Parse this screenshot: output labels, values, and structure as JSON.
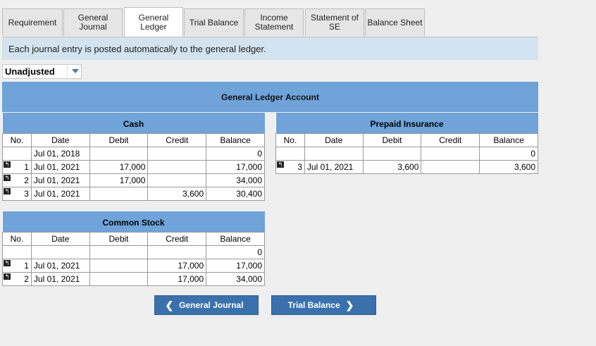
{
  "tabs": [
    {
      "label": "Requirement",
      "active": false
    },
    {
      "label": "General\nJournal",
      "active": false
    },
    {
      "label": "General\nLedger",
      "active": true
    },
    {
      "label": "Trial Balance",
      "active": false
    },
    {
      "label": "Income\nStatement",
      "active": false
    },
    {
      "label": "Statement of\nSE",
      "active": false
    },
    {
      "label": "Balance Sheet",
      "active": false
    }
  ],
  "notice": "Each journal entry is posted automatically to the general ledger.",
  "selector": {
    "value": "Unadjusted"
  },
  "gl_title": "General Ledger Account",
  "columns": {
    "no": "No.",
    "date": "Date",
    "debit": "Debit",
    "credit": "Credit",
    "balance": "Balance"
  },
  "cash": {
    "title": "Cash",
    "rows": [
      {
        "no": "",
        "date": "Jul 01, 2018",
        "debit": "",
        "credit": "",
        "balance": "0",
        "flag": false
      },
      {
        "no": "1",
        "date": "Jul 01, 2021",
        "debit": "17,000",
        "credit": "",
        "balance": "17,000",
        "flag": true
      },
      {
        "no": "2",
        "date": "Jul 01, 2021",
        "debit": "17,000",
        "credit": "",
        "balance": "34,000",
        "flag": true
      },
      {
        "no": "3",
        "date": "Jul 01, 2021",
        "debit": "",
        "credit": "3,600",
        "balance": "30,400",
        "flag": true
      }
    ]
  },
  "prepaid": {
    "title": "Prepaid Insurance",
    "rows": [
      {
        "no": "",
        "date": "",
        "debit": "",
        "credit": "",
        "balance": "0",
        "flag": false
      },
      {
        "no": "3",
        "date": "Jul 01, 2021",
        "debit": "3,600",
        "credit": "",
        "balance": "3,600",
        "flag": true
      }
    ]
  },
  "stock": {
    "title": "Common Stock",
    "rows": [
      {
        "no": "",
        "date": "",
        "debit": "",
        "credit": "",
        "balance": "0",
        "flag": false
      },
      {
        "no": "1",
        "date": "Jul 01, 2021",
        "debit": "",
        "credit": "17,000",
        "balance": "17,000",
        "flag": true
      },
      {
        "no": "2",
        "date": "Jul 01, 2021",
        "debit": "",
        "credit": "17,000",
        "balance": "34,000",
        "flag": true
      }
    ]
  },
  "buttons": {
    "prev": "General Journal",
    "next": "Trial Balance",
    "prev_icon": "chevron-left-icon",
    "next_icon": "chevron-right-icon"
  },
  "colors": {
    "header_blue": "#6fa3d9",
    "button_blue": "#3a71ac",
    "notice_bg": "#d3e3ef"
  }
}
